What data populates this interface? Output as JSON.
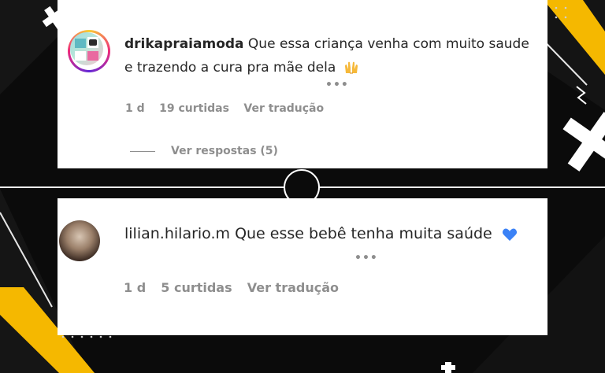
{
  "comments": [
    {
      "username": "drikapraiamoda",
      "text": "Que essa criança venha com muito saude e trazendo a cura pra mãe dela",
      "emoji_icon": "raising-hands-icon",
      "more": "•••",
      "time": "1 d",
      "likes": "19 curtidas",
      "translate": "Ver tradução",
      "replies": "Ver respostas (5)"
    },
    {
      "username": "lilian.hilario.m",
      "text": "Que esse bebê tenha muita saúde",
      "emoji_icon": "blue-heart-icon",
      "more": "•••",
      "time": "1 d",
      "likes": "5 curtidas",
      "translate": "Ver tradução"
    }
  ],
  "colors": {
    "background": "#0b0b0b",
    "accent_yellow": "#f5b800",
    "card": "#ffffff",
    "text": "#262626",
    "meta": "#8e8e8e",
    "heart": "#3b82f6"
  }
}
